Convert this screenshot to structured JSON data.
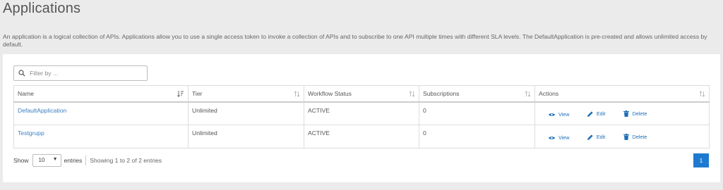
{
  "page": {
    "title": "Applications",
    "description": "An application is a logical collection of APIs. Applications allow you to use a single access token to invoke a collection of APIs and to subscribe to one API multiple times with different SLA levels. The DefaultApplication is pre-created and allows unlimited access by default."
  },
  "filter": {
    "placeholder": "Filter by ..."
  },
  "table": {
    "columns": [
      "Name",
      "Tier",
      "Workflow Status",
      "Subscriptions",
      "Actions"
    ],
    "rows": [
      {
        "name": "DefaultApplication",
        "tier": "Unlimited",
        "status": "ACTIVE",
        "subscriptions": "0"
      },
      {
        "name": "Testgrupp",
        "tier": "Unlimited",
        "status": "ACTIVE",
        "subscriptions": "0"
      }
    ],
    "actions": {
      "view": "View",
      "edit": "Edit",
      "delete": "Delete"
    }
  },
  "footer": {
    "show_label": "Show",
    "page_size": "10",
    "entries_label": "entries",
    "info": "Showing 1 to 2 of 2 entries",
    "current_page": "1"
  },
  "colors": {
    "accent": "#1e7ad0",
    "link": "#3a7fc1",
    "background": "#ebebeb"
  }
}
